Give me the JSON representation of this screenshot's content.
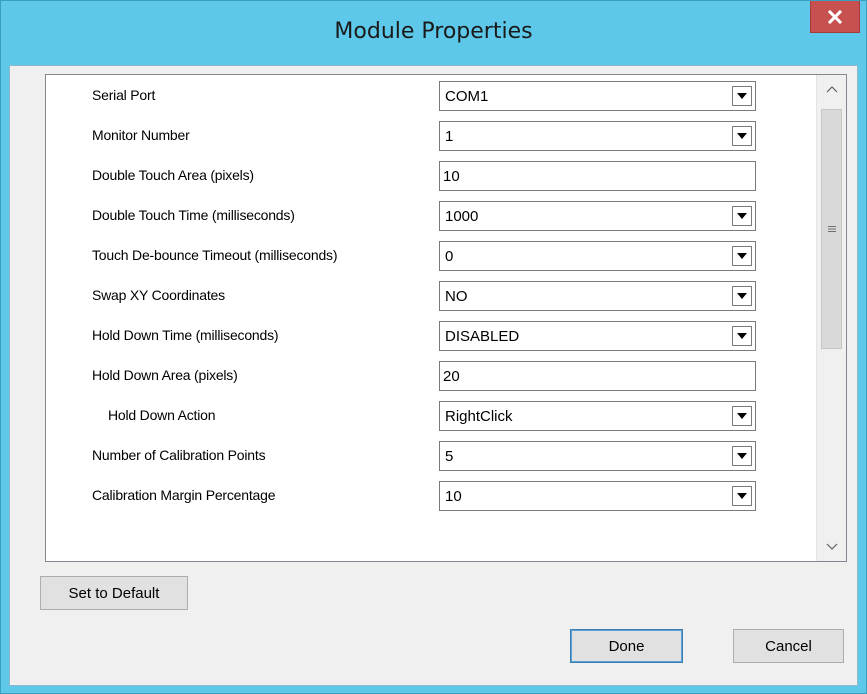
{
  "window": {
    "title": "Module Properties",
    "close_label": "x",
    "background": "#5ec8ea"
  },
  "properties": [
    {
      "label": "Serial Port",
      "type": "dropdown",
      "value": "COM1"
    },
    {
      "label": "Monitor Number",
      "type": "dropdown",
      "value": "1"
    },
    {
      "label": "Double Touch Area (pixels)",
      "type": "text",
      "value": "10"
    },
    {
      "label": "Double Touch Time (milliseconds)",
      "type": "dropdown",
      "value": "1000"
    },
    {
      "label": "Touch De-bounce Timeout (milliseconds)",
      "type": "dropdown",
      "value": "0"
    },
    {
      "label": "Swap XY Coordinates",
      "type": "dropdown",
      "value": "NO"
    },
    {
      "label": "Hold Down Time (milliseconds)",
      "type": "dropdown",
      "value": "DISABLED"
    },
    {
      "label": "Hold Down Area (pixels)",
      "type": "text",
      "value": "20"
    },
    {
      "label": "Hold Down Action",
      "type": "dropdown",
      "value": "RightClick",
      "indented": true
    },
    {
      "label": "Number of Calibration Points",
      "type": "dropdown",
      "value": "5"
    },
    {
      "label": "Calibration Margin Percentage",
      "type": "dropdown",
      "value": "10"
    }
  ],
  "buttons": {
    "set_default": "Set to Default",
    "done": "Done",
    "cancel": "Cancel"
  },
  "icons": {
    "dropdown": "chevron-down-icon",
    "scroll_up": "chevron-up-icon",
    "scroll_down": "chevron-down-icon",
    "thumb_grip": "grip-icon",
    "close": "close-icon"
  }
}
